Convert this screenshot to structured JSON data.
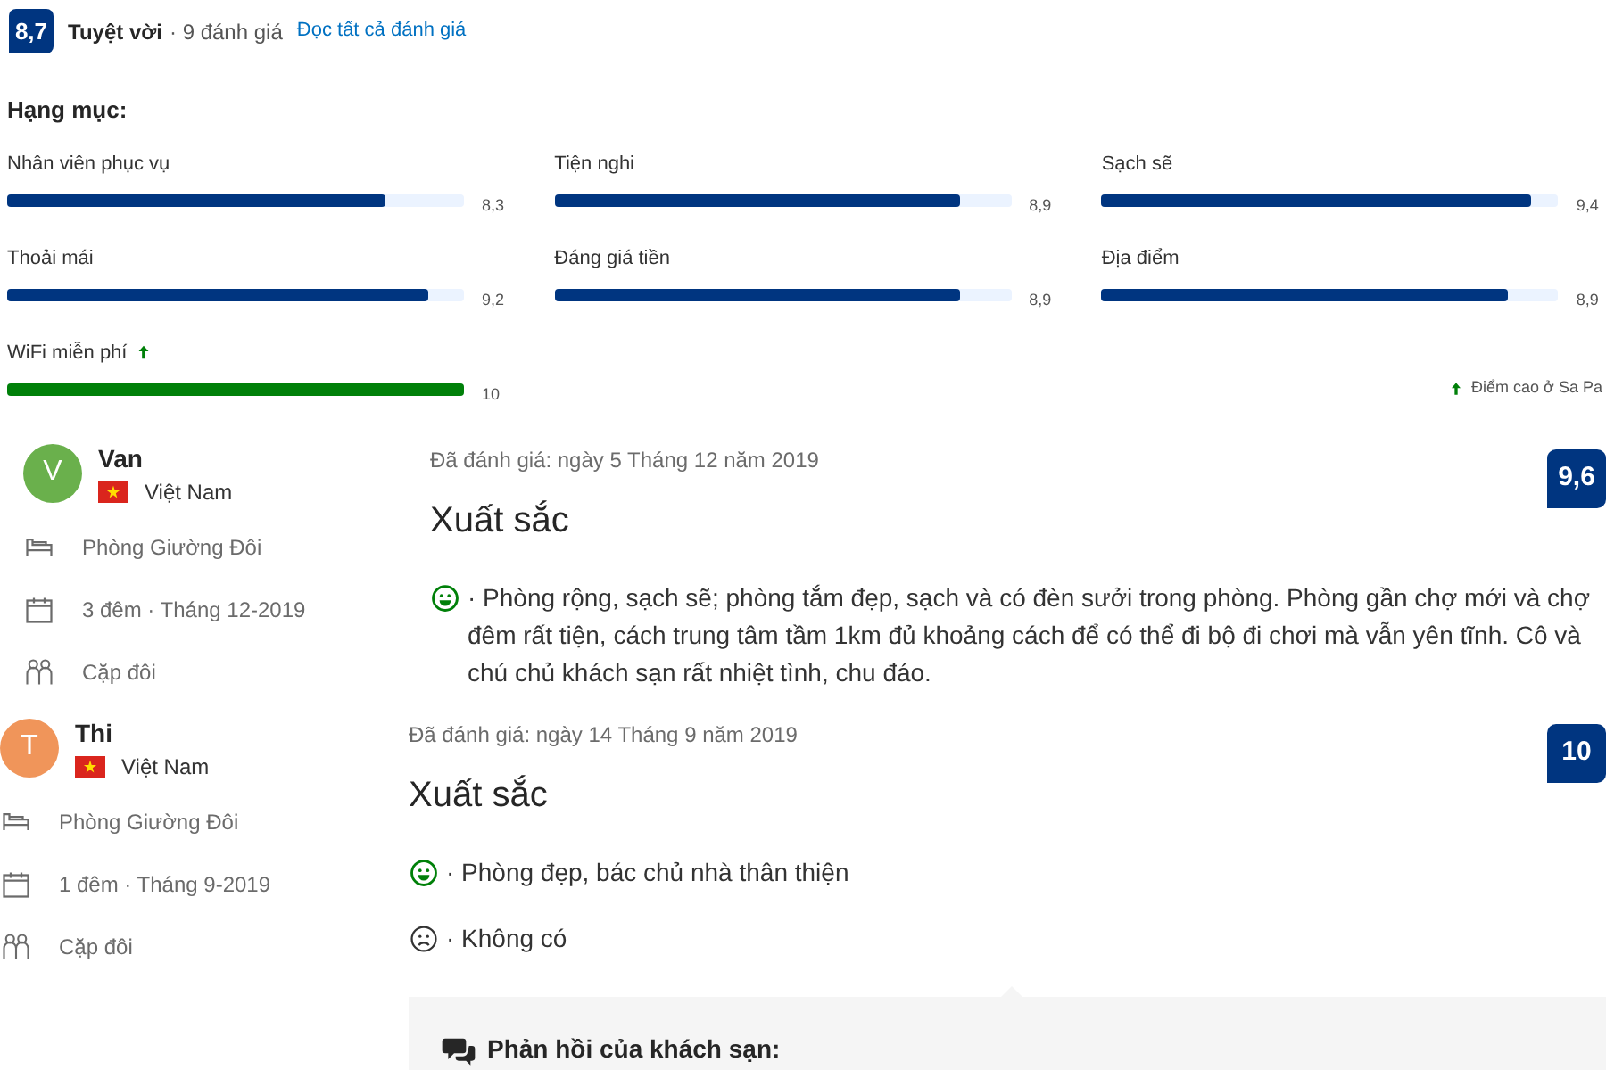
{
  "summary": {
    "score": "8,7",
    "label": "Tuyệt vời",
    "count": "· 9 đánh giá",
    "link": "Đọc tất cả đánh giá"
  },
  "categories_title": "Hạng mục:",
  "categories": [
    {
      "name": "Nhân viên phục vụ",
      "score": "8,3",
      "level": 0.83,
      "highlight": false
    },
    {
      "name": "Tiện nghi",
      "score": "8,9",
      "level": 0.89,
      "highlight": false
    },
    {
      "name": "Sạch sẽ",
      "score": "9,4",
      "level": 0.94,
      "highlight": false
    },
    {
      "name": "Thoải mái",
      "score": "9,2",
      "level": 0.92,
      "highlight": false
    },
    {
      "name": "Đáng giá tiền",
      "score": "8,9",
      "level": 0.89,
      "highlight": false
    },
    {
      "name": "Địa điểm",
      "score": "8,9",
      "level": 0.89,
      "highlight": false
    },
    {
      "name": "WiFi miễn phí",
      "score": "10",
      "level": 1,
      "highlight": true
    }
  ],
  "highlight_note": "Điểm cao ở Sa Pa",
  "reviews": [
    {
      "initial": "V",
      "color": "#6ab04c",
      "name": "Van",
      "country": "Việt Nam",
      "room": "Phòng Giường Đôi",
      "stay": "3 đêm · Tháng 12-2019",
      "group": "Cặp đôi",
      "date": "Đã đánh giá: ngày 5 Tháng 12 năm 2019",
      "title": "Xuất sắc",
      "score": "9,6",
      "comments": [
        {
          "kind": "positive",
          "text": "· Phòng rộng, sạch sẽ; phòng tắm đẹp, sạch và có đèn sưởi trong phòng. Phòng gần chợ mới và chợ đêm rất tiện, cách trung tâm tầm 1km đủ khoảng cách để có thể đi bộ đi chơi mà vẫn yên tĩnh. Cô và chú chủ khách sạn rất nhiệt tình, chu đáo."
        }
      ]
    },
    {
      "initial": "T",
      "color": "#f0955a",
      "name": "Thi",
      "country": "Việt Nam",
      "room": "Phòng Giường Đôi",
      "stay": "1 đêm · Tháng 9-2019",
      "group": "Cặp đôi",
      "date": "Đã đánh giá: ngày 14 Tháng 9 năm 2019",
      "title": "Xuất sắc",
      "score": "10",
      "comments": [
        {
          "kind": "positive",
          "text": "· Phòng đẹp, bác chủ nhà thân thiện"
        },
        {
          "kind": "negative",
          "text": "· Không có"
        }
      ],
      "response": {
        "title": "Phản hồi của khách sạn:"
      }
    }
  ]
}
